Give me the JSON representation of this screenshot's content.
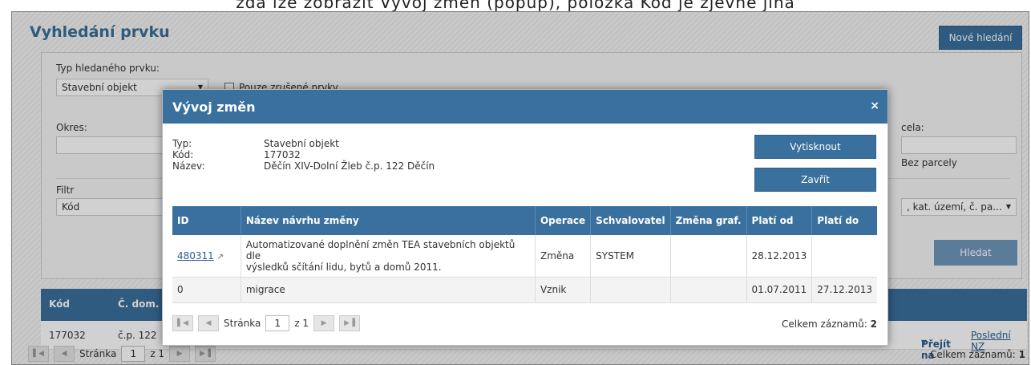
{
  "top_strip_text": "zda lze zobrazit Vývoj změn (popup), položka Kód je zjevně jiná",
  "page": {
    "title": "Vyhledání prvku",
    "new_search": "Nové hledání"
  },
  "filter": {
    "type_label": "Typ hledaného prvku:",
    "type_value": "Stavební objekt",
    "only_cancelled_label": "Pouze zrušené prvky",
    "okres_label": "Okres:",
    "parcela_label": "cela:",
    "bez_parcely_label": "Bez parcely",
    "filtr_label": "Filtr",
    "filtr_value": "Kód",
    "search_scope_value": ", kat. území, č. pa...",
    "search_button": "Hledat"
  },
  "results": {
    "columns": [
      "Kód",
      "Č. dom."
    ],
    "row": {
      "kod": "177032",
      "cdom": "č.p. 122"
    },
    "goto_label": "Přejít na",
    "last_nz": "Poslední NZ",
    "pager": {
      "page_label": "Stránka",
      "page_value": "1",
      "of_label": "z 1"
    },
    "total_label": "Celkem záznamů:",
    "total_value": "1"
  },
  "modal": {
    "title": "Vývoj změn",
    "close_glyph": "×",
    "typ_label": "Typ:",
    "typ_value": "Stavební objekt",
    "kod_label": "Kód:",
    "kod_value": "177032",
    "nazev_label": "Název:",
    "nazev_value": "Děčín XIV-Dolní Žleb č.p. 122 Děčín",
    "print_button": "Vytisknout",
    "close_button": "Zavřít",
    "table": {
      "headers": [
        "ID",
        "Název návrhu změny",
        "Operace",
        "Schvalovatel",
        "Změna graf.",
        "Platí od",
        "Platí do"
      ],
      "rows": [
        {
          "id": "480311",
          "name_line1": "Automatizované doplnění změn TEA stavebních objektů dle",
          "name_line2": "výsledků sčítání lidu, bytů a domů 2011.",
          "operace": "Změna",
          "schvalovatel": "SYSTEM",
          "zmena_graf": "",
          "plati_od": "28.12.2013",
          "plati_do": ""
        },
        {
          "id": "0",
          "name": "migrace",
          "operace": "Vznik",
          "schvalovatel": "",
          "zmena_graf": "",
          "plati_od": "01.07.2011",
          "plati_do": "27.12.2013"
        }
      ]
    },
    "pager": {
      "page_label": "Stránka",
      "page_value": "1",
      "of_label": "z 1"
    },
    "total_label": "Celkem záznamů:",
    "total_value": "2"
  },
  "icons": {
    "first": "first-page-icon",
    "prev": "prev-page-icon",
    "next": "next-page-icon",
    "last": "last-page-icon",
    "external": "external-link-icon"
  },
  "colors": {
    "accent": "#3a709d",
    "title": "#3b6e98"
  }
}
